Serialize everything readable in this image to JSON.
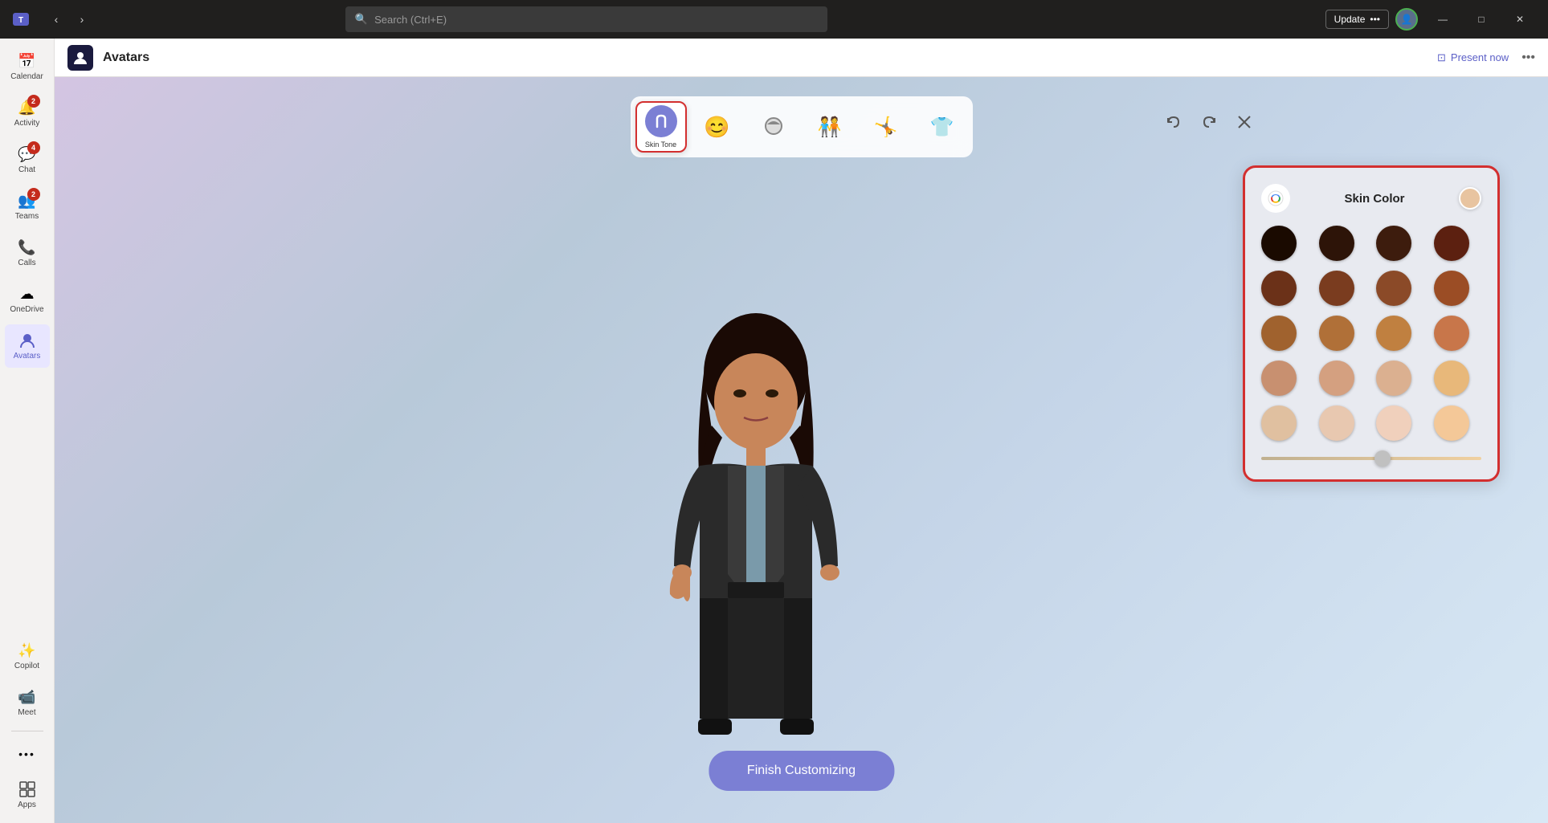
{
  "titleBar": {
    "searchPlaceholder": "Search (Ctrl+E)",
    "updateLabel": "Update",
    "updateEllipsis": "•••",
    "minimize": "—",
    "maximize": "□",
    "close": "✕"
  },
  "sidebar": {
    "items": [
      {
        "id": "calendar",
        "label": "Calendar",
        "icon": "📅",
        "badge": null,
        "active": false
      },
      {
        "id": "activity",
        "label": "Activity",
        "icon": "🔔",
        "badge": "2",
        "active": false
      },
      {
        "id": "chat",
        "label": "Chat",
        "icon": "💬",
        "badge": "4",
        "active": false
      },
      {
        "id": "teams",
        "label": "Teams",
        "icon": "👥",
        "badge": "2",
        "active": false
      },
      {
        "id": "calls",
        "label": "Calls",
        "icon": "📞",
        "badge": null,
        "active": false
      },
      {
        "id": "onedrive",
        "label": "OneDrive",
        "icon": "☁",
        "badge": null,
        "active": false
      },
      {
        "id": "avatars",
        "label": "Avatars",
        "icon": "🧍",
        "badge": null,
        "active": true
      }
    ],
    "bottomItems": [
      {
        "id": "copilot",
        "label": "Copilot",
        "icon": "✨",
        "badge": null
      },
      {
        "id": "meet",
        "label": "Meet",
        "icon": "📹",
        "badge": null
      },
      {
        "id": "more",
        "label": "•••",
        "icon": "•••",
        "badge": null
      },
      {
        "id": "apps",
        "label": "Apps",
        "icon": "⊞",
        "badge": null
      }
    ]
  },
  "appHeader": {
    "title": "Avatars",
    "presentNow": "Present now",
    "moreOptions": "•••"
  },
  "categoryToolbar": {
    "items": [
      {
        "id": "skin-tone",
        "label": "Skin Tone",
        "icon": "skin",
        "active": true
      },
      {
        "id": "face",
        "label": "",
        "icon": "😊",
        "active": false
      },
      {
        "id": "hair",
        "label": "",
        "icon": "👤",
        "active": false
      },
      {
        "id": "body",
        "label": "",
        "icon": "🧑‍🤝‍🧑",
        "active": false
      },
      {
        "id": "accessories",
        "label": "",
        "icon": "🤸",
        "active": false
      },
      {
        "id": "clothing",
        "label": "",
        "icon": "👕",
        "active": false
      }
    ]
  },
  "skinPanel": {
    "title": "Skin Color",
    "previewColor": "#e8c4a0",
    "colors": {
      "row1": [
        "#1a0a00",
        "#2d1408",
        "#3d1c0d",
        "#5c2010"
      ],
      "row2": [
        "#6b3118",
        "#7a3c1f",
        "#8b4a28",
        "#9b4d25"
      ],
      "row3": [
        "#a0622e",
        "#b07038",
        "#c08040",
        "#c8764a"
      ],
      "row4": [
        "#c89070",
        "#d4a080",
        "#dbb090",
        "#e8b87a"
      ],
      "row5": [
        "#e0c0a0",
        "#e8c8b0",
        "#f0d0bc",
        "#f4c898"
      ]
    }
  },
  "finishButton": {
    "label": "Finish Customizing"
  },
  "editToolbar": {
    "undo": "↺",
    "redo": "↻",
    "close": "✕"
  }
}
